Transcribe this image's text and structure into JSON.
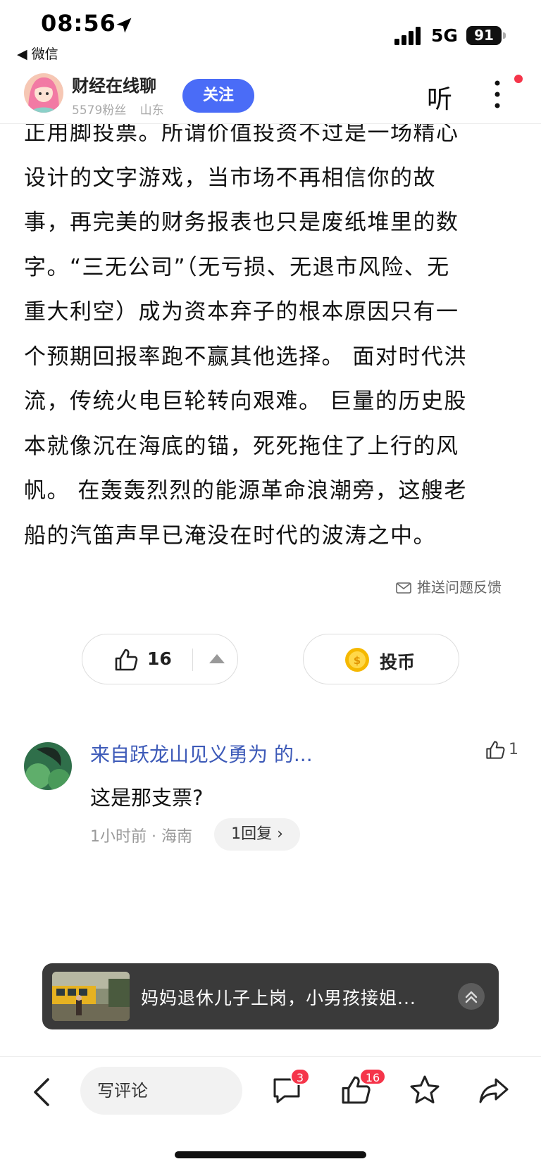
{
  "status_bar": {
    "time": "08:56",
    "back_app": "◀ 微信",
    "network": "5G",
    "battery": "91"
  },
  "author": {
    "name": "财经在线聊",
    "fans": "5579粉丝",
    "location": "山东",
    "follow_label": "关注",
    "listen_label": "听"
  },
  "article": {
    "lines": [
      "正用脚投票。所谓价值投资不过是一场精心",
      "设计的文字游戏，当市场不再相信你的故",
      "事，再完美的财务报表也只是废纸堆里的数",
      "字。“三无公司”（无亏损、无退市风险、无",
      "重大利空）成为资本弃子的根本原因只有一",
      "个预期回报率跑不赢其他选择。 面对时代洪",
      "流，传统火电巨轮转向艰难。 巨量的历史股",
      "本就像沉在海底的锚，死死拖住了上行的风",
      "帆。 在轰轰烈烈的能源革命浪潮旁，这艘老",
      "船的汽笛声早已淹没在时代的波涛之中。"
    ],
    "feedback_label": "推送问题反馈"
  },
  "actions": {
    "like_count": "16",
    "coin_label": "投币"
  },
  "comment": {
    "author": "来自跃龙山见义勇为 的...",
    "like_count": "1",
    "text": "这是那支票?",
    "meta": "1小时前 · 海南",
    "reply_label": "1回复 ›"
  },
  "banner": {
    "text": "妈妈退休儿子上岗，小男孩接姐..."
  },
  "bottom_bar": {
    "comment_placeholder": "写评论",
    "comment_badge": "3",
    "like_badge": "16"
  },
  "colors": {
    "accent": "#4a6cf7",
    "link": "#3d5ab8",
    "badge": "#f5354a"
  }
}
